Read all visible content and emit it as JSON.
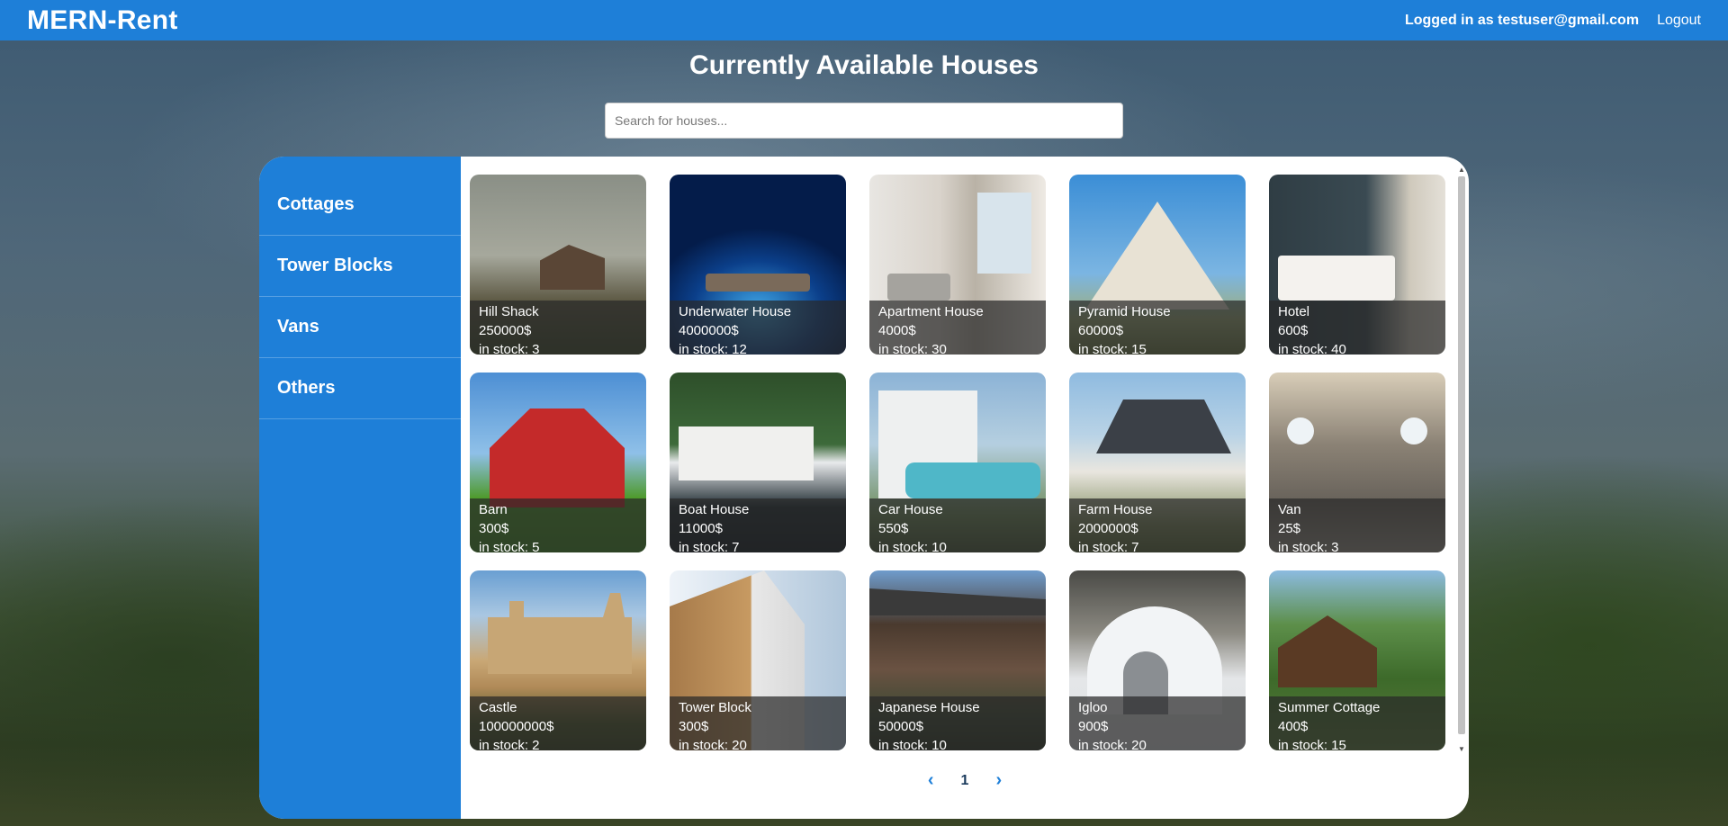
{
  "navbar": {
    "brand": "MERN-Rent",
    "user_label": "Logged in as testuser@gmail.com",
    "logout_label": "Logout"
  },
  "page": {
    "title": "Currently Available Houses",
    "search_placeholder": "Search for houses..."
  },
  "sidebar": {
    "items": [
      {
        "label": "Cottages"
      },
      {
        "label": "Tower Blocks"
      },
      {
        "label": "Vans"
      },
      {
        "label": "Others"
      }
    ]
  },
  "houses": [
    {
      "name": "Hill Shack",
      "price": "250000$",
      "stock": "in stock: 3"
    },
    {
      "name": "Underwater House",
      "price": "4000000$",
      "stock": "in stock: 12"
    },
    {
      "name": "Apartment House",
      "price": "4000$",
      "stock": "in stock: 30"
    },
    {
      "name": "Pyramid House",
      "price": "60000$",
      "stock": "in stock: 15"
    },
    {
      "name": "Hotel",
      "price": "600$",
      "stock": "in stock: 40"
    },
    {
      "name": "Barn",
      "price": "300$",
      "stock": "in stock: 5"
    },
    {
      "name": "Boat House",
      "price": "11000$",
      "stock": "in stock: 7"
    },
    {
      "name": "Car House",
      "price": "550$",
      "stock": "in stock: 10"
    },
    {
      "name": "Farm House",
      "price": "2000000$",
      "stock": "in stock: 7"
    },
    {
      "name": "Van",
      "price": "25$",
      "stock": "in stock: 3"
    },
    {
      "name": "Castle",
      "price": "100000000$",
      "stock": "in stock: 2"
    },
    {
      "name": "Tower Block",
      "price": "300$",
      "stock": "in stock: 20"
    },
    {
      "name": "Japanese House",
      "price": "50000$",
      "stock": "in stock: 10"
    },
    {
      "name": "Igloo",
      "price": "900$",
      "stock": "in stock: 20"
    },
    {
      "name": "Summer Cottage",
      "price": "400$",
      "stock": "in stock: 15"
    }
  ],
  "pager": {
    "prev_icon": "chevron-left-icon",
    "current_page": "1",
    "next_icon": "chevron-right-icon"
  },
  "colors": {
    "accent": "#1e7fd8",
    "panel": "#ffffff"
  }
}
